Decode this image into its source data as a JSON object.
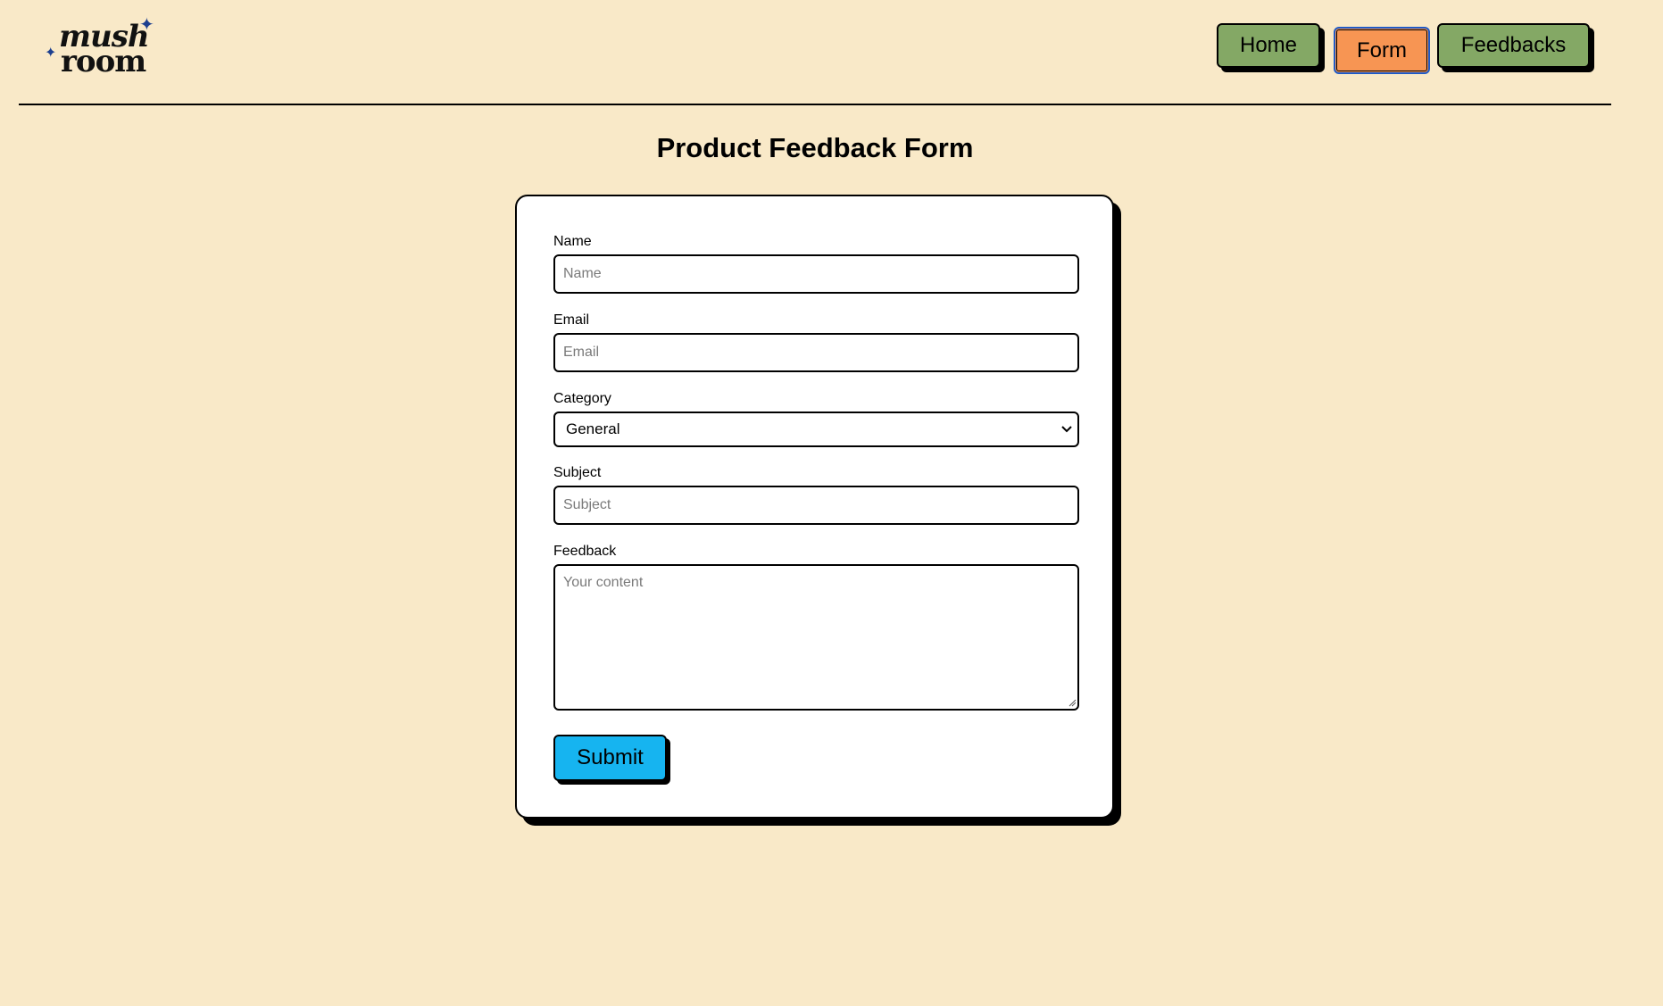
{
  "header": {
    "logo": {
      "line1": "mush",
      "line2": "room",
      "accent_color": "#1c3f8f"
    },
    "nav": {
      "home_label": "Home",
      "form_label": "Form",
      "feedbacks_label": "Feedbacks",
      "active": "Form"
    }
  },
  "main": {
    "title": "Product Feedback Form"
  },
  "form": {
    "name": {
      "label": "Name",
      "placeholder": "Name",
      "value": ""
    },
    "email": {
      "label": "Email",
      "placeholder": "Email",
      "value": ""
    },
    "category": {
      "label": "Category",
      "selected": "General"
    },
    "subject": {
      "label": "Subject",
      "placeholder": "Subject",
      "value": ""
    },
    "feedback": {
      "label": "Feedback",
      "placeholder": "Your content",
      "value": ""
    },
    "submit_label": "Submit"
  },
  "colors": {
    "background": "#f9e9c8",
    "nav_button": "#84a865",
    "nav_active": "#f79553",
    "submit_button": "#16b4f0"
  }
}
